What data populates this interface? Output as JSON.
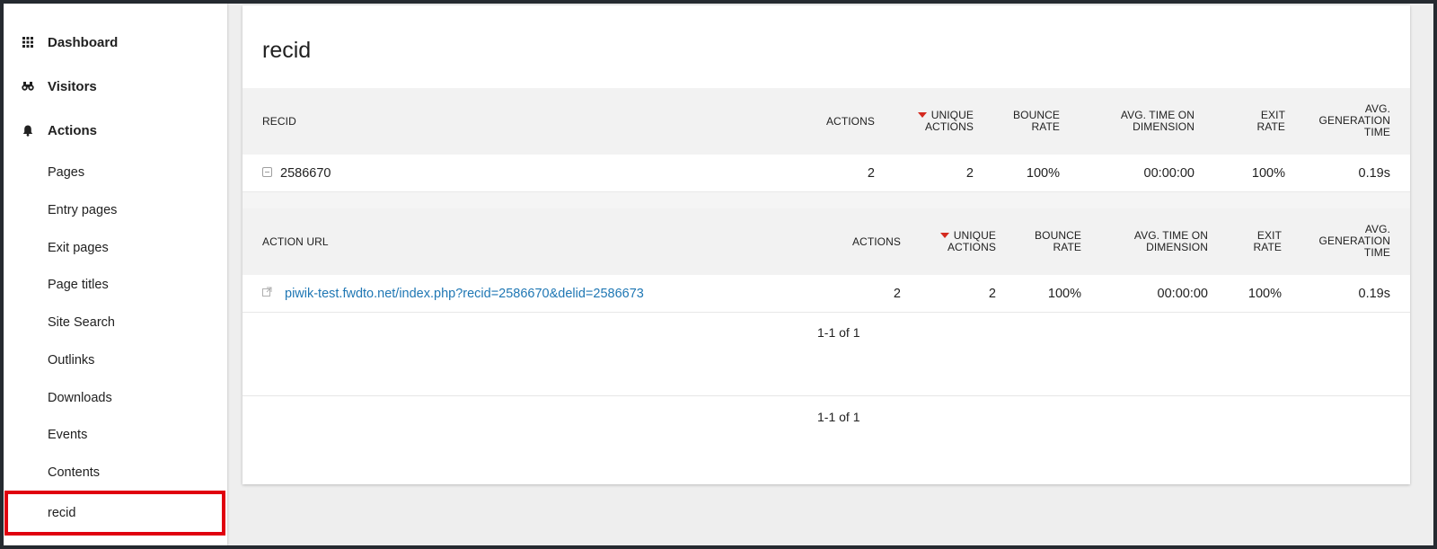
{
  "sidebar": {
    "categories": [
      {
        "label": "Dashboard",
        "icon": "grid-icon"
      },
      {
        "label": "Visitors",
        "icon": "binoculars-icon"
      },
      {
        "label": "Actions",
        "icon": "bell-icon"
      }
    ],
    "sub_items": [
      {
        "label": "Pages"
      },
      {
        "label": "Entry pages"
      },
      {
        "label": "Exit pages"
      },
      {
        "label": "Page titles"
      },
      {
        "label": "Site Search"
      },
      {
        "label": "Outlinks"
      },
      {
        "label": "Downloads"
      },
      {
        "label": "Events"
      },
      {
        "label": "Contents"
      },
      {
        "label": "recid"
      }
    ],
    "highlight_color": "#e0000f"
  },
  "report": {
    "title": "recid",
    "table": {
      "headers": {
        "dimension": "RECID",
        "actions": "ACTIONS",
        "unique_actions_1": "UNIQUE",
        "unique_actions_2": "ACTIONS",
        "bounce_1": "BOUNCE",
        "bounce_2": "RATE",
        "avg_time_1": "AVG. TIME ON",
        "avg_time_2": "DIMENSION",
        "exit_1": "EXIT",
        "exit_2": "RATE",
        "gen_1": "AVG.",
        "gen_2": "GENERATION",
        "gen_3": "TIME"
      },
      "row": {
        "label": "2586670",
        "actions": "2",
        "unique_actions": "2",
        "bounce_rate": "100%",
        "avg_time": "00:00:00",
        "exit_rate": "100%",
        "gen_time": "0.19s"
      }
    },
    "subtable": {
      "headers": {
        "dimension": "ACTION URL",
        "actions": "ACTIONS",
        "unique_actions_1": "UNIQUE",
        "unique_actions_2": "ACTIONS",
        "bounce_1": "BOUNCE",
        "bounce_2": "RATE",
        "avg_time_1": "AVG. TIME ON",
        "avg_time_2": "DIMENSION",
        "exit_1": "EXIT",
        "exit_2": "RATE",
        "gen_1": "AVG.",
        "gen_2": "GENERATION",
        "gen_3": "TIME"
      },
      "row": {
        "url": "piwik-test.fwdto.net/index.php?recid=2586670&delid=2586673",
        "actions": "2",
        "unique_actions": "2",
        "bounce_rate": "100%",
        "avg_time": "00:00:00",
        "exit_rate": "100%",
        "gen_time": "0.19s"
      },
      "pagination": "1-1 of 1"
    },
    "pagination": "1-1 of 1",
    "sort_indicator_color": "#d4291f",
    "link_color": "#1f77b4"
  }
}
